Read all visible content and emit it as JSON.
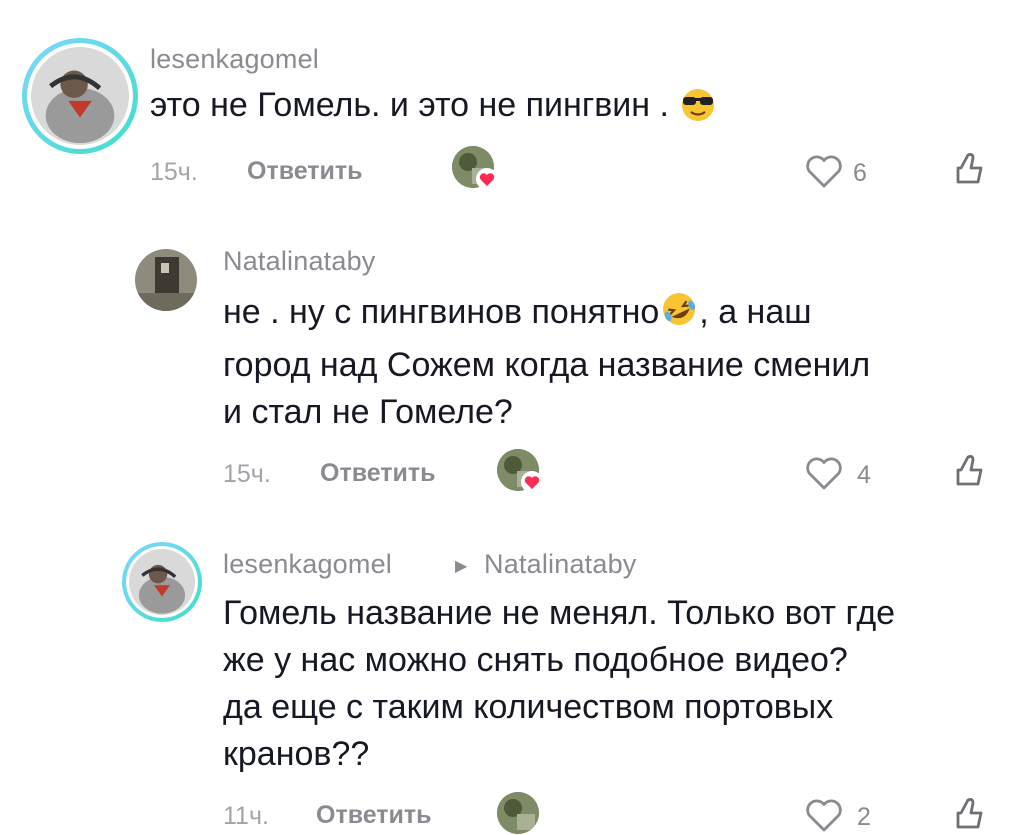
{
  "comments": [
    {
      "username": "lesenkagomel",
      "text": "это не Гомель. и это не пингвин .",
      "time": "15ч.",
      "reply_label": "Ответить",
      "likes": "6"
    },
    {
      "username": "Natalinataby",
      "line1_a": "не . ну с пингвинов понятно",
      "line1_b": ", а наш",
      "line2": "город над Сожем когда название сменил",
      "line3": "и стал не Гомеле?",
      "time": "15ч.",
      "reply_label": "Ответить",
      "likes": "4"
    },
    {
      "username": "lesenkagomel",
      "reply_to": "Natalinataby",
      "line1": "Гомель название не менял. Только вот где",
      "line2": "же у нас можно снять подобное видео?",
      "line3": "да еще с таким количеством портовых",
      "line4": "кранов??",
      "time": "11ч.",
      "reply_label": "Ответить",
      "likes": "2"
    }
  ],
  "colors": {
    "ring_start": "#7fd6ff",
    "ring_end": "#3ee0c8",
    "heart_badge": "#fe2c55",
    "secondary_text": "#8a8b91"
  }
}
